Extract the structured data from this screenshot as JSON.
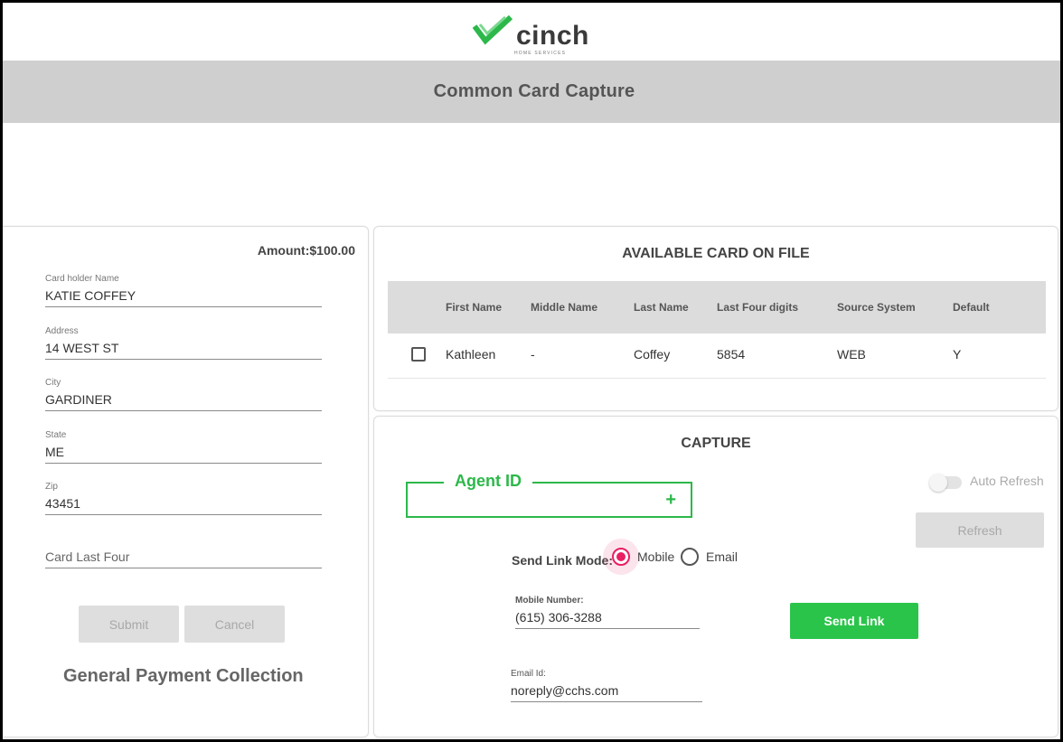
{
  "brand": {
    "name": "cinch",
    "tagline": "HOME SERVICES",
    "accent_color": "#2cb84a"
  },
  "header": {
    "title": "Common Card Capture"
  },
  "payment_form": {
    "amount": "Amount:$100.00",
    "fields": [
      {
        "label": "Card holder Name",
        "value": "KATIE COFFEY"
      },
      {
        "label": "Address",
        "value": "14 WEST ST"
      },
      {
        "label": "City",
        "value": "GARDINER"
      },
      {
        "label": "State",
        "value": "ME"
      },
      {
        "label": "Zip",
        "value": "43451"
      }
    ],
    "card_last_four_placeholder": "Card Last Four",
    "submit_label": "Submit",
    "cancel_label": "Cancel",
    "footer_title": "General Payment Collection"
  },
  "cards_on_file": {
    "title": "AVAILABLE CARD ON FILE",
    "columns": [
      "First Name",
      "Middle Name",
      "Last Name",
      "Last Four digits",
      "Source System",
      "Default"
    ],
    "rows": [
      {
        "checked": false,
        "cells": [
          "Kathleen",
          "-",
          "Coffey",
          "5854",
          "WEB",
          "Y"
        ]
      }
    ]
  },
  "capture": {
    "title": "CAPTURE",
    "agent_id_label": "Agent ID",
    "agent_id_add_icon": "+",
    "auto_refresh_label": "Auto Refresh",
    "auto_refresh_on": false,
    "refresh_label": "Refresh",
    "send_link_mode_label": "Send Link Mode:",
    "modes": [
      {
        "label": "Mobile",
        "selected": true
      },
      {
        "label": "Email",
        "selected": false
      }
    ],
    "mobile_label": "Mobile Number:",
    "mobile_value": "(615) 306-3288",
    "email_label": "Email Id:",
    "email_value": "noreply@cchs.com",
    "send_link_label": "Send Link",
    "radio_selected_color": "#e91e63",
    "send_button_color": "#2bc44a"
  }
}
